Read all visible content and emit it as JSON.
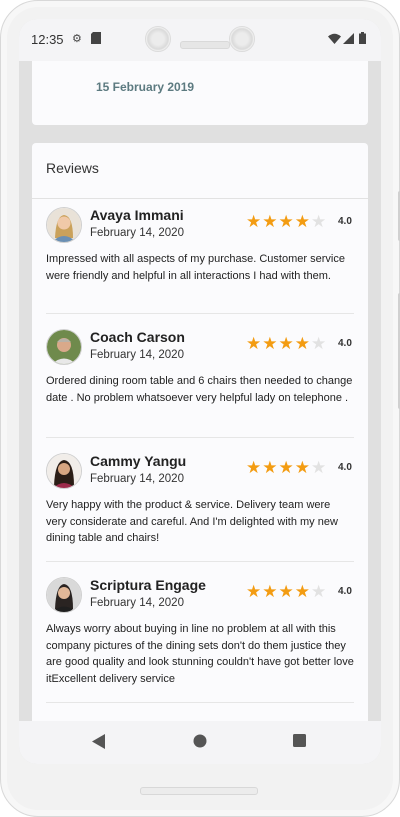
{
  "status": {
    "time": "12:35"
  },
  "info_card": {
    "date": "15 February 2019"
  },
  "reviews_section": {
    "title": "Reviews"
  },
  "reviews": [
    {
      "name": "Avaya Immani",
      "date": "February 14, 2020",
      "rating": "4.0",
      "stars_filled": 4,
      "text": "Impressed with all aspects of my purchase. Customer service were friendly and helpful in all interactions I had with them."
    },
    {
      "name": "Coach Carson",
      "date": "February 14, 2020",
      "rating": "4.0",
      "stars_filled": 4,
      "text": "Ordered dining room table and 6 chairs then needed to change date . No problem whatsoever very helpful lady on telephone ."
    },
    {
      "name": "Cammy Yangu",
      "date": "February 14, 2020",
      "rating": "4.0",
      "stars_filled": 4,
      "text": "Very happy with the product & service. Delivery team were very considerate and careful. And I'm delighted with my new dining table and chairs!"
    },
    {
      "name": "Scriptura Engage",
      "date": "February 14, 2020",
      "rating": "4.0",
      "stars_filled": 4,
      "text": "Always worry about buying in line no problem at all with this company pictures of the dining sets don't do them justice they are good quality and look stunning couldn't have got better love itExcellent delivery service"
    }
  ],
  "colors": {
    "star": "#f39c12",
    "accent_date": "#5c7a80"
  },
  "icons": [
    "settings-icon",
    "sd-card-icon",
    "wifi-icon",
    "signal-icon",
    "battery-icon",
    "back-icon",
    "home-icon",
    "recents-icon",
    "star-icon"
  ]
}
